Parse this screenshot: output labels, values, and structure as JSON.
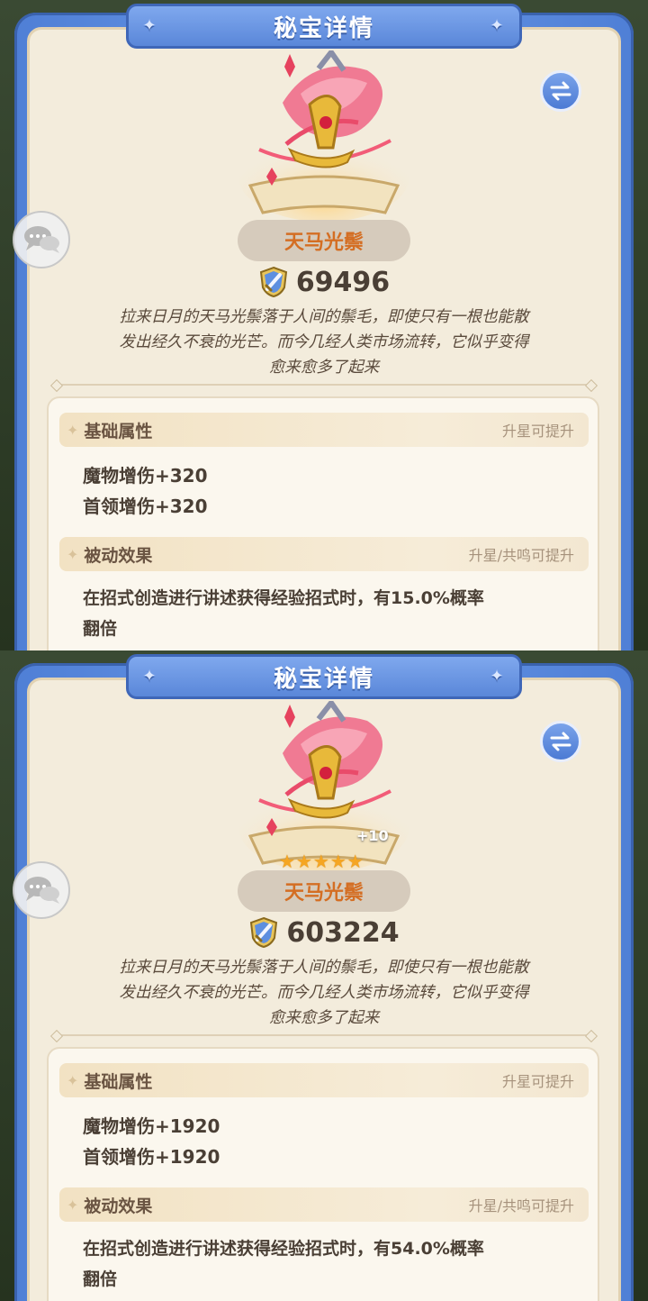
{
  "panels": [
    {
      "title": "秘宝详情",
      "item_name": "天马光鬃",
      "power": "69496",
      "level_label": "",
      "stars": 0,
      "description": [
        "拉来日月的天马光鬃落于人间的鬃毛，即使只有一根也能散",
        "发出经久不衰的光芒。而今几经人类市场流转，它似乎变得",
        "愈来愈多了起来"
      ],
      "basic_title": "基础属性",
      "basic_hint": "升星可提升",
      "stats": [
        "魔物增伤+320",
        "首领增伤+320"
      ],
      "passive_title": "被动效果",
      "passive_hint": "升星/共鸣可提升",
      "passive_lines": [
        "在招式创造进行讲述获得经验招式时，有15.0%概率",
        "翻倍"
      ]
    },
    {
      "title": "秘宝详情",
      "item_name": "天马光鬃",
      "power": "603224",
      "level_label": "+10",
      "stars": 5,
      "description": [
        "拉来日月的天马光鬃落于人间的鬃毛，即使只有一根也能散",
        "发出经久不衰的光芒。而今几经人类市场流转，它似乎变得",
        "愈来愈多了起来"
      ],
      "basic_title": "基础属性",
      "basic_hint": "升星可提升",
      "stats": [
        "魔物增伤+1920",
        "首领增伤+1920"
      ],
      "passive_title": "被动效果",
      "passive_hint": "升星/共鸣可提升",
      "passive_lines": [
        "在招式创造进行讲述获得经验招式时，有54.0%概率",
        "翻倍"
      ]
    }
  ],
  "icons": {
    "swap": "swap-arrows-icon",
    "chat": "chat-bubbles-icon",
    "power": "shield-sword-icon",
    "sparkle": "sparkle-icon",
    "star": "star-icon"
  },
  "colors": {
    "frame_blue": "#5a87d9",
    "card_bg": "#f3ecdc",
    "item_name": "#d46e23",
    "text_dark": "#4a3f35",
    "star": "#f5a623"
  }
}
